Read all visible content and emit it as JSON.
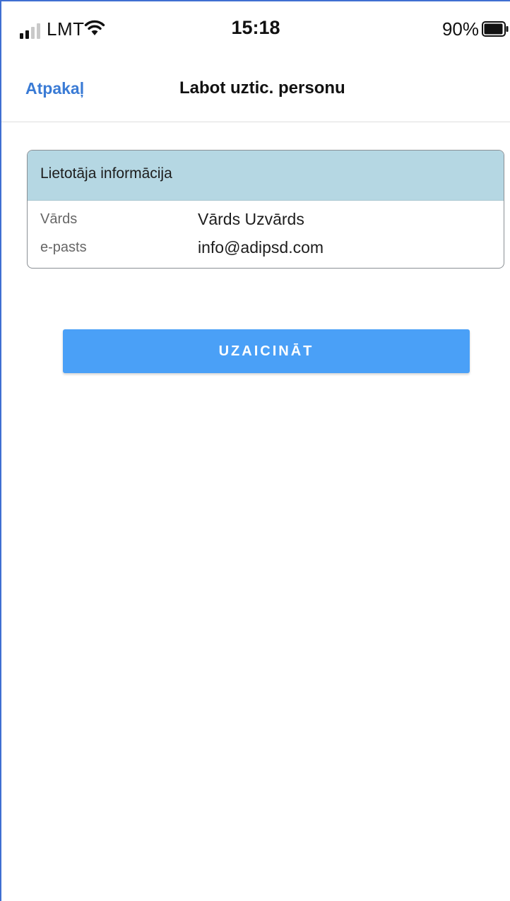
{
  "status_bar": {
    "carrier": "LMT",
    "time": "15:18",
    "battery_percent": "90%",
    "icons": [
      "signal-icon",
      "wifi-icon",
      "battery-icon"
    ]
  },
  "nav": {
    "back_label": "Atpakaļ",
    "title": "Labot uztic. personu"
  },
  "user_info": {
    "header": "Lietotāja informācija",
    "rows": [
      {
        "label": "Vārds",
        "value": "Vārds Uzvārds"
      },
      {
        "label": "e-pasts",
        "value": "info@adipsd.com"
      }
    ]
  },
  "invite_button": {
    "label": "UZAICINĀT"
  },
  "colors": {
    "accent": "#3a7bd5",
    "button": "#4aa0f7",
    "card_header": "#b5d7e3"
  }
}
